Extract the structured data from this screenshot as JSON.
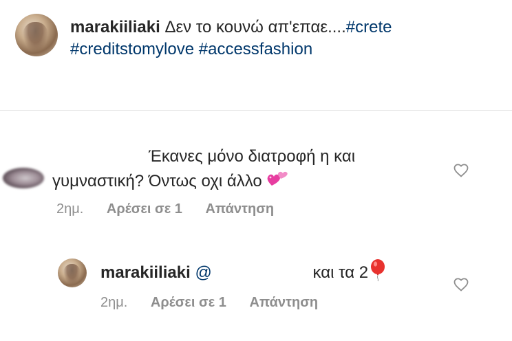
{
  "caption": {
    "username": "marakiiliaki",
    "text": "Δεν το κουνώ απ'επαε....",
    "hashtags": [
      "#crete",
      "#creditstomylove",
      "#accessfashion"
    ]
  },
  "comment": {
    "text_line1": "Έκανες μόνο διατροφή η και",
    "text_line2": "γυμναστική? Όντως οχι άλλο",
    "emoji": "two-hearts-emoji",
    "time": "2ημ.",
    "likes": "Αρέσει σε 1",
    "reply_label": "Απάντηση"
  },
  "reply": {
    "username": "marakiiliaki",
    "mention": "@",
    "text": "και τα 2",
    "emoji": "balloon-emoji",
    "time": "2ημ.",
    "likes": "Αρέσει σε 1",
    "reply_label": "Απάντηση"
  },
  "colors": {
    "text": "#262626",
    "link": "#00376b",
    "meta": "#8e8e8e",
    "divider": "#e6e6e6",
    "heart_outline": "#8e8e8e"
  }
}
